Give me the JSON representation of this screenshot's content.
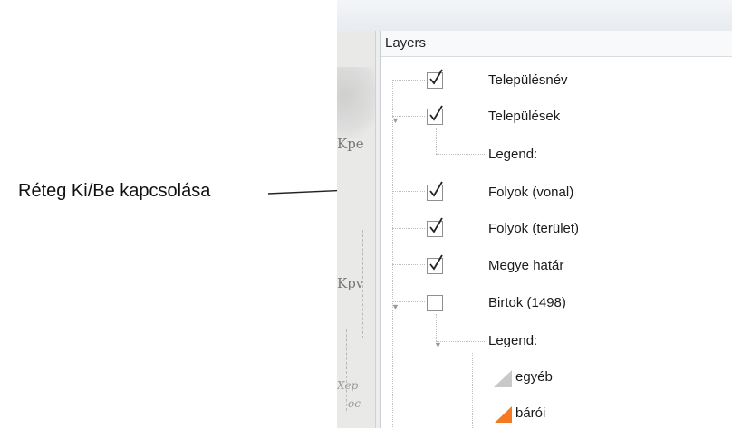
{
  "annotation": {
    "text": "Réteg Ki/Be kapcsolása"
  },
  "map": {
    "labels": [
      "Kpe",
      "Kpv",
      "Xep",
      "oc"
    ]
  },
  "layers": {
    "title": "Layers",
    "items": [
      {
        "label": "Településnév",
        "checked": true
      },
      {
        "label": "Települések",
        "checked": true,
        "expanded": true
      },
      {
        "label": "Legend:"
      },
      {
        "label": "Folyok (vonal)",
        "checked": true
      },
      {
        "label": "Folyok (terület)",
        "checked": true
      },
      {
        "label": "Megye határ",
        "checked": true
      },
      {
        "label": "Birtok (1498)",
        "checked": false,
        "expanded": true
      },
      {
        "label": "Legend:",
        "expanded": true
      },
      {
        "label": "egyéb",
        "color": "#c8c8c8"
      },
      {
        "label": "bárói",
        "color": "#f47920"
      }
    ]
  }
}
